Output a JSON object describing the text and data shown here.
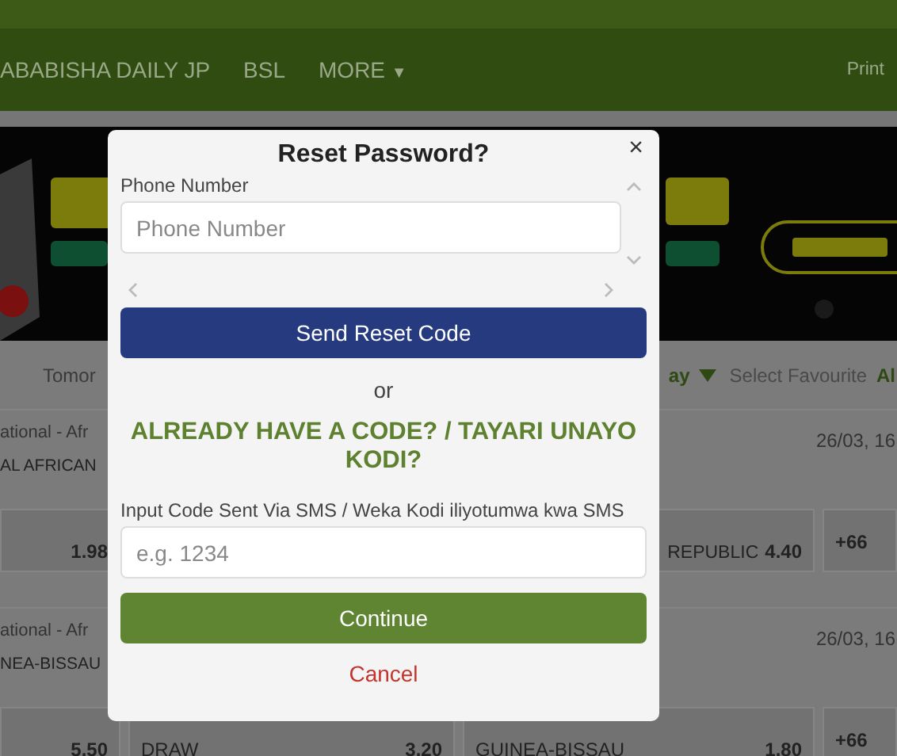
{
  "nav": {
    "items": [
      {
        "label": "ABABISHA DAILY JP",
        "kind": "link"
      },
      {
        "label": "BSL",
        "kind": "link"
      },
      {
        "label": "MORE",
        "kind": "dropdown",
        "caret": "▼"
      }
    ],
    "right": "Print"
  },
  "filters": {
    "left": "Tomor",
    "day": "ay",
    "favourite": "Select Favourite",
    "all": "Al"
  },
  "matches": [
    {
      "league": "ational - Afr",
      "date": "26/03, 16",
      "team": "AL AFRICAN",
      "odds": [
        {
          "value": "1.98"
        },
        {
          "name": "REPUBLIC",
          "value": "4.40"
        }
      ],
      "more": "+66"
    },
    {
      "league": "ational - Afr",
      "date": "26/03, 16",
      "team": "NEA-BISSAU",
      "odds": [
        {
          "value": "5.50"
        },
        {
          "name": "DRAW",
          "value": "3.20"
        },
        {
          "name": "GUINEA-BISSAU",
          "value": "1.80"
        }
      ],
      "more": "+66"
    }
  ],
  "modal": {
    "title": "Reset Password?",
    "close": "×",
    "phone": {
      "label": "Phone Number",
      "placeholder": "Phone Number"
    },
    "send_button": "Send Reset Code",
    "separator": "or",
    "heading": "ALREADY HAVE A CODE? / TAYARI UNAYO KODI?",
    "code": {
      "label": "Input Code Sent Via SMS / Weka Kodi iliyotumwa kwa SMS",
      "placeholder": "e.g. 1234"
    },
    "continue_button": "Continue",
    "cancel": "Cancel"
  }
}
